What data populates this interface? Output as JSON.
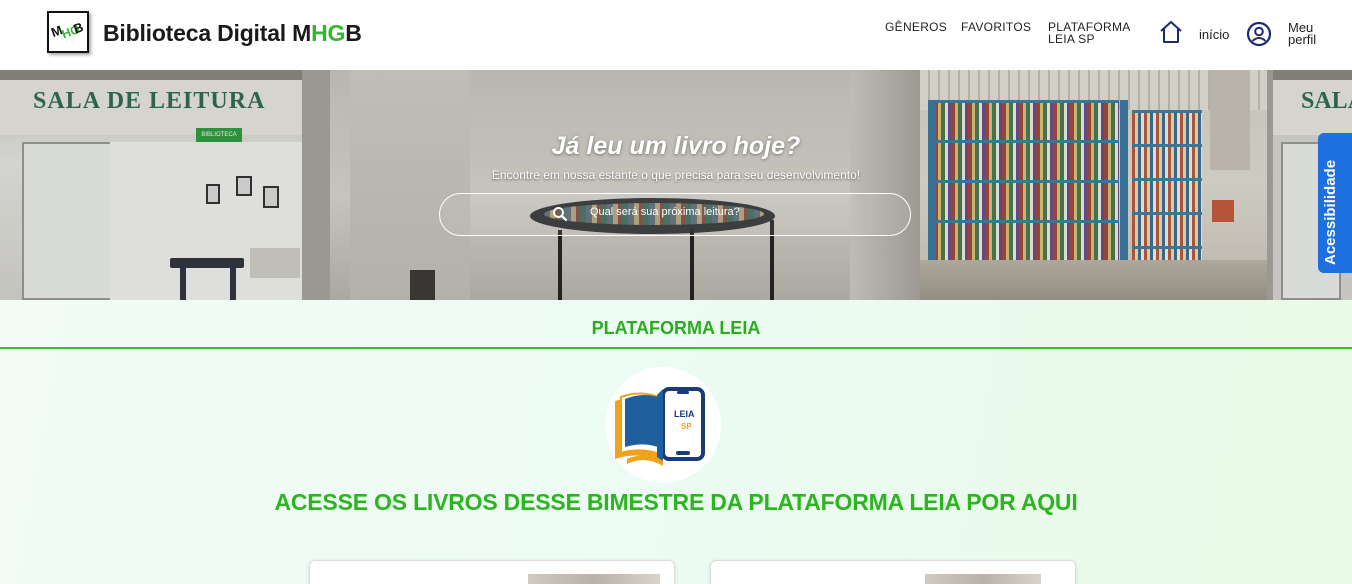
{
  "header": {
    "title_prefix": "Biblioteca Digital M",
    "title_highlight": "HG",
    "title_suffix": "B",
    "logo_text": "MHGB",
    "nav": {
      "generos": "GÊNEROS",
      "favoritos": "FAVORITOS",
      "plataforma_line1": "PLATAFORMA",
      "plataforma_line2": "LEIA SP",
      "inicio": "início",
      "perfil_line1": "Meu",
      "perfil_line2": "perfil"
    }
  },
  "hero": {
    "title": "Já leu um livro hoje?",
    "subtitle": "Encontre em nossa estante o que precisa para seu desenvolvimento!",
    "search_placeholder": "Qual será sua próxima leitura?",
    "sign_text": "SALA DE LEITURA",
    "biblioteca_tag": "BIBLIOTECA",
    "sign_text_right": "SALA"
  },
  "accessibility": {
    "label": "Acessibilidade",
    "color": "#1e6fe0"
  },
  "section": {
    "title": "PLATAFORMA LEIA",
    "logo_text": "LEIA",
    "logo_sub": "SP",
    "heading": "ACESSE OS LIVROS DESSE BIMESTRE DA PLATAFORMA LEIA POR AQUI",
    "accent_color": "#2db51f"
  },
  "icons": [
    "home-icon",
    "user-icon",
    "search-icon"
  ]
}
